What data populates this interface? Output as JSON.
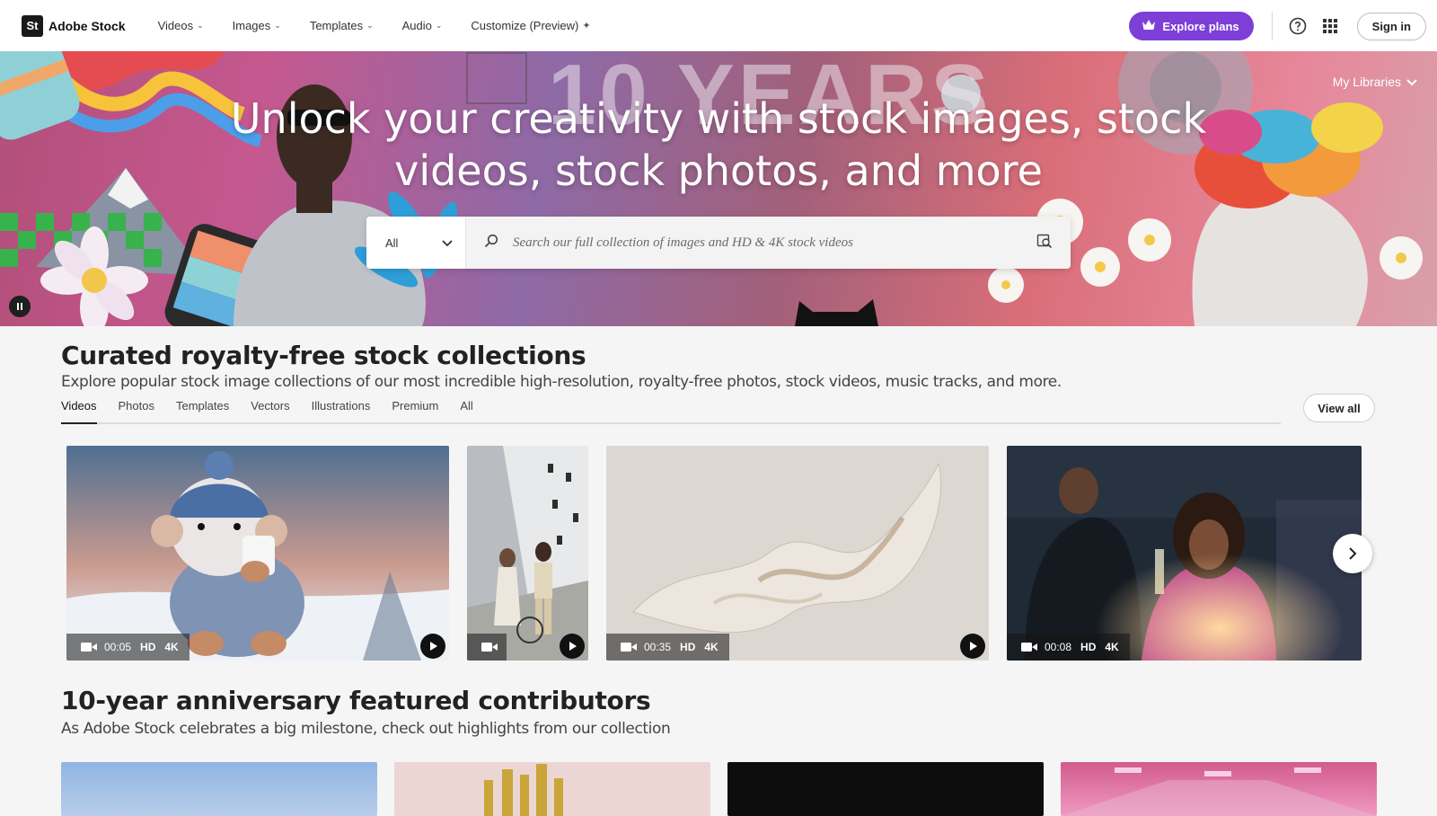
{
  "brand": {
    "logo_mark": "St",
    "name": "Adobe Stock"
  },
  "nav": {
    "links": [
      {
        "label": "Videos",
        "has_dropdown": true
      },
      {
        "label": "Images",
        "has_dropdown": true
      },
      {
        "label": "Templates",
        "has_dropdown": true
      },
      {
        "label": "Audio",
        "has_dropdown": true
      },
      {
        "label": "Customize (Preview)",
        "has_dropdown": false
      }
    ],
    "explore_label": "Explore plans",
    "signin_label": "Sign in",
    "icons": [
      "help-icon",
      "app-grid-icon",
      "crown-icon",
      "sparkle-icon"
    ]
  },
  "hero": {
    "background_text": "10 YEARS",
    "title_line1": "Unlock your creativity with stock images, stock",
    "title_line2": "videos, stock photos, and more",
    "my_libraries": "My Libraries",
    "search": {
      "category": "All",
      "placeholder": "Search our full collection of images and HD & 4K stock videos"
    }
  },
  "curated": {
    "title": "Curated royalty-free stock collections",
    "subtitle": "Explore popular stock image collections of our most incredible high-resolution, royalty-free photos, stock videos, music tracks, and more.",
    "tabs": [
      "Videos",
      "Photos",
      "Templates",
      "Vectors",
      "Illustrations",
      "Premium",
      "All"
    ],
    "active_tab": "Videos",
    "view_all": "View all",
    "cards": [
      {
        "duration": "00:05",
        "hd": "HD",
        "k4": "4K",
        "subject": "knitted snowman toy drinking from a cup"
      },
      {
        "duration": "",
        "hd": "",
        "k4": "",
        "subject": "couple walking with bicycle"
      },
      {
        "duration": "00:35",
        "hd": "HD",
        "k4": "4K",
        "subject": "flowing white silk fabric"
      },
      {
        "duration": "00:08",
        "hd": "HD",
        "k4": "4K",
        "subject": "woman toasting with champagne at party"
      }
    ]
  },
  "contributors": {
    "title": "10-year anniversary featured contributors",
    "subtitle": "As Adobe Stock celebrates a big milestone, check out highlights from our collection"
  },
  "colors": {
    "accent": "#7d3fd8",
    "nav_bg": "#ffffff",
    "page_bg": "#f5f5f5"
  }
}
